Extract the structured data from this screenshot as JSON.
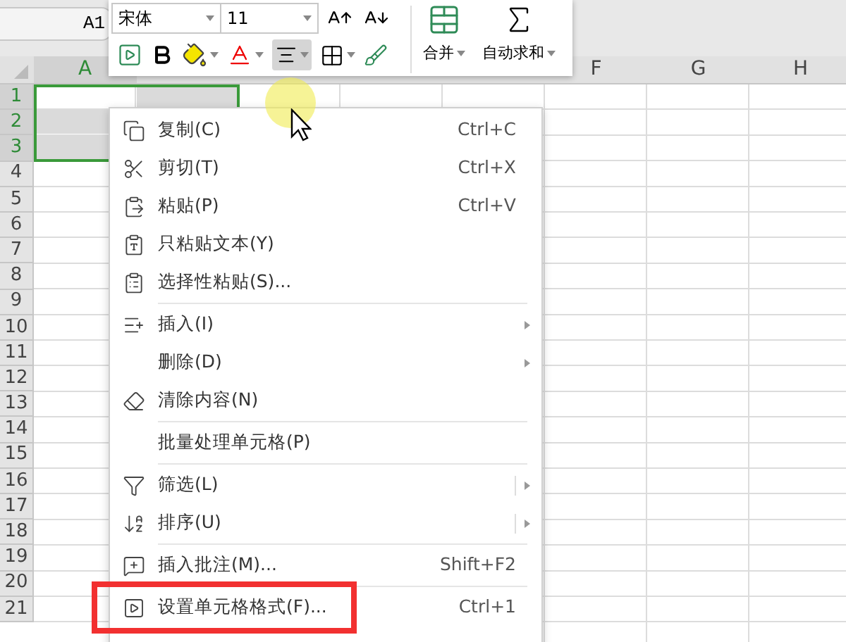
{
  "name_box": "A1",
  "toolbar": {
    "font": "宋体",
    "size": "11",
    "merge": "合并",
    "autosum": "自动求和",
    "align_active": true
  },
  "columns": [
    {
      "label": "A",
      "selected": true
    },
    {
      "selected": true
    },
    {
      "label": "F",
      "selected": false
    },
    {
      "label": "G",
      "selected": false
    },
    {
      "label": "H",
      "selected": false
    }
  ],
  "rows": [
    {
      "label": "1",
      "selected": true
    },
    {
      "label": "2",
      "selected": true
    },
    {
      "label": "3",
      "selected": true
    },
    {
      "label": "4",
      "selected": false
    },
    {
      "label": "5",
      "selected": false
    },
    {
      "label": "6",
      "selected": false
    },
    {
      "label": "7",
      "selected": false
    },
    {
      "label": "8",
      "selected": false
    },
    {
      "label": "9",
      "selected": false
    },
    {
      "label": "10",
      "selected": false
    },
    {
      "label": "11",
      "selected": false
    },
    {
      "label": "12",
      "selected": false
    },
    {
      "label": "13",
      "selected": false
    },
    {
      "label": "14",
      "selected": false
    },
    {
      "label": "15",
      "selected": false
    },
    {
      "label": "16",
      "selected": false
    },
    {
      "label": "17",
      "selected": false
    },
    {
      "label": "18",
      "selected": false
    },
    {
      "label": "19",
      "selected": false
    },
    {
      "label": "20",
      "selected": false
    },
    {
      "label": "21",
      "selected": false
    }
  ],
  "context_menu": [
    {
      "kind": "item",
      "label": "复制(C)",
      "shortcut": "Ctrl+C",
      "submenu": false,
      "highlighted": false
    },
    {
      "kind": "item",
      "label": "剪切(T)",
      "shortcut": "Ctrl+X",
      "submenu": false,
      "highlighted": false
    },
    {
      "kind": "item",
      "label": "粘贴(P)",
      "shortcut": "Ctrl+V",
      "submenu": false,
      "highlighted": false
    },
    {
      "kind": "item",
      "label": "只粘贴文本(Y)",
      "submenu": false,
      "highlighted": false
    },
    {
      "kind": "item",
      "label": "选择性粘贴(S)...",
      "submenu": false,
      "highlighted": false
    },
    {
      "kind": "separator"
    },
    {
      "kind": "item",
      "label": "插入(I)",
      "submenu": true,
      "split": false,
      "highlighted": false
    },
    {
      "kind": "item",
      "label": "删除(D)",
      "submenu": true,
      "split": false,
      "highlighted": false
    },
    {
      "kind": "item",
      "label": "清除内容(N)",
      "submenu": false,
      "highlighted": false
    },
    {
      "kind": "separator"
    },
    {
      "kind": "item",
      "label": "批量处理单元格(P)",
      "submenu": false,
      "highlighted": false
    },
    {
      "kind": "separator"
    },
    {
      "kind": "item",
      "label": "筛选(L)",
      "submenu": true,
      "split": true,
      "highlighted": false
    },
    {
      "kind": "item",
      "label": "排序(U)",
      "submenu": true,
      "split": true,
      "highlighted": false
    },
    {
      "kind": "separator"
    },
    {
      "kind": "item",
      "label": "插入批注(M)...",
      "shortcut": "Shift+F2",
      "submenu": false,
      "highlighted": false
    },
    {
      "kind": "separator"
    },
    {
      "kind": "item",
      "label": "设置单元格格式(F)...",
      "shortcut": "Ctrl+1",
      "submenu": false,
      "highlighted": true
    }
  ]
}
